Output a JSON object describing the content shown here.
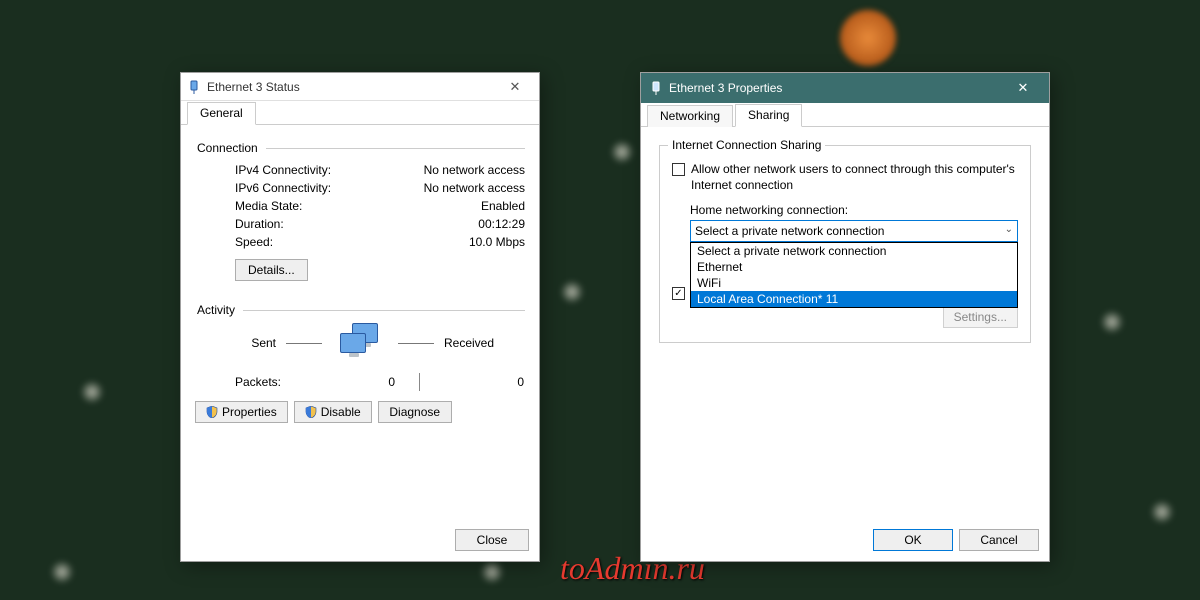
{
  "watermark": "toAdmin.ru",
  "status_window": {
    "title": "Ethernet 3 Status",
    "tab_general": "General",
    "group_connection": "Connection",
    "ipv4_label": "IPv4 Connectivity:",
    "ipv4_value": "No network access",
    "ipv6_label": "IPv6 Connectivity:",
    "ipv6_value": "No network access",
    "media_label": "Media State:",
    "media_value": "Enabled",
    "duration_label": "Duration:",
    "duration_value": "00:12:29",
    "speed_label": "Speed:",
    "speed_value": "10.0 Mbps",
    "details_btn": "Details...",
    "group_activity": "Activity",
    "sent_label": "Sent",
    "received_label": "Received",
    "packets_label": "Packets:",
    "packets_sent": "0",
    "packets_recv": "0",
    "properties_btn": "Properties",
    "disable_btn": "Disable",
    "diagnose_btn": "Diagnose",
    "close_btn": "Close"
  },
  "props_window": {
    "title": "Ethernet 3 Properties",
    "tab_networking": "Networking",
    "tab_sharing": "Sharing",
    "group_ics": "Internet Connection Sharing",
    "allow_label": "Allow other network users to connect through this computer's Internet connection",
    "home_label": "Home networking connection:",
    "combo_selected": "Select a private network connection",
    "options": [
      "Select a private network connection",
      "Ethernet",
      "WiFi",
      "Local Area Connection* 11"
    ],
    "allow_control_label": "",
    "settings_btn": "Settings...",
    "ok_btn": "OK",
    "cancel_btn": "Cancel"
  }
}
